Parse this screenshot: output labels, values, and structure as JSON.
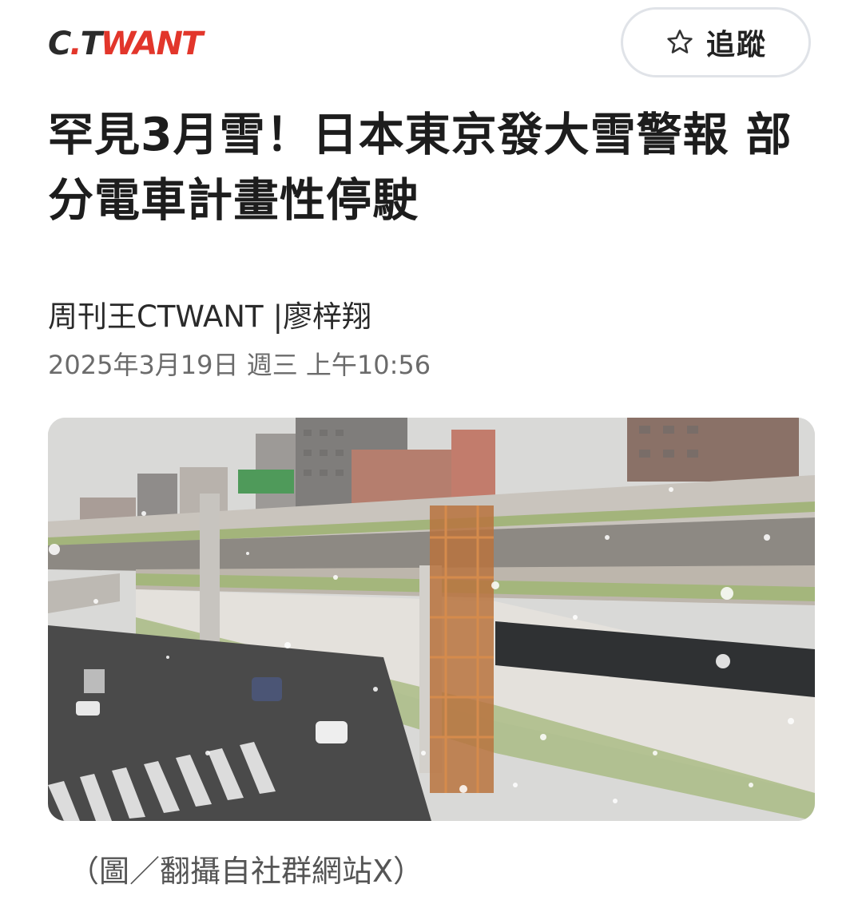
{
  "header": {
    "logo_text_dark_1": "C",
    "logo_text_red_1": ".",
    "logo_text_dark_2": "T",
    "logo_text_red_2": "WANT",
    "follow_label": "追蹤",
    "follow_icon": "star-outline-icon"
  },
  "article": {
    "title": "罕見3月雪！日本東京發大雪警報 部分電車計畫性停駛",
    "byline_source": "周刊王CTWANT",
    "byline_separator": "|",
    "byline_author": "廖梓翔",
    "timestamp": "2025年3月19日 週三 上午10:56",
    "image_caption": "（圖／翻攝自社群網站X）"
  },
  "colors": {
    "brand_red": "#e2362b",
    "brand_dark": "#2b2b2b",
    "follow_border": "#e0e3e8",
    "timestamp_gray": "#6b6b6b"
  }
}
